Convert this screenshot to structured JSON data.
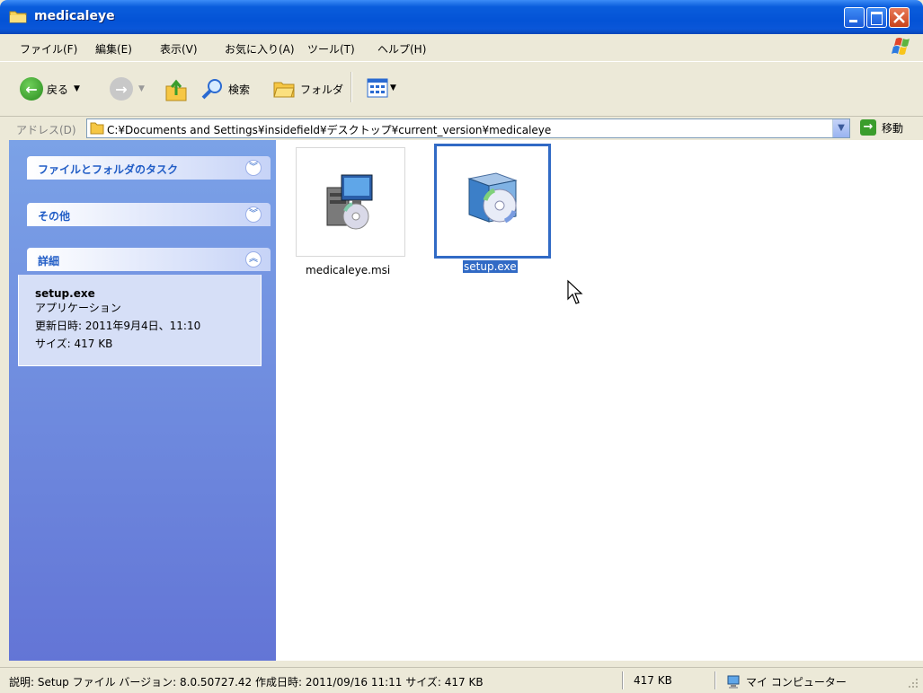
{
  "window": {
    "title": "medicaleye"
  },
  "menu": {
    "items": [
      "ファイル(F)",
      "編集(E)",
      "表示(V)",
      "お気に入り(A)",
      "ツール(T)",
      "ヘルプ(H)"
    ]
  },
  "toolbar": {
    "back_label": "戻る",
    "search_label": "検索",
    "folders_label": "フォルダ"
  },
  "address": {
    "label": "アドレス(D)",
    "path": "C:¥Documents and Settings¥insidefield¥デスクトップ¥current_version¥medicaleye",
    "go_label": "移動"
  },
  "tasks": {
    "file_folder_tasks": "ファイルとフォルダのタスク",
    "other_places": "その他",
    "details": "詳細",
    "details_name": "setup.exe",
    "details_type": "アプリケーション",
    "details_modified": "更新日時: 2011年9月4日、11:10",
    "details_size": "サイズ: 417 KB"
  },
  "files": [
    {
      "name": "medicaleye.msi",
      "icon": "msi-installer-icon",
      "selected": false
    },
    {
      "name": "setup.exe",
      "icon": "setup-exe-icon",
      "selected": true
    }
  ],
  "status": {
    "description": "説明: Setup ファイル バージョン: 8.0.50727.42 作成日時: 2011/09/16 11:11 サイズ: 417 KB",
    "size": "417 KB",
    "zone": "マイ コンピューター"
  }
}
